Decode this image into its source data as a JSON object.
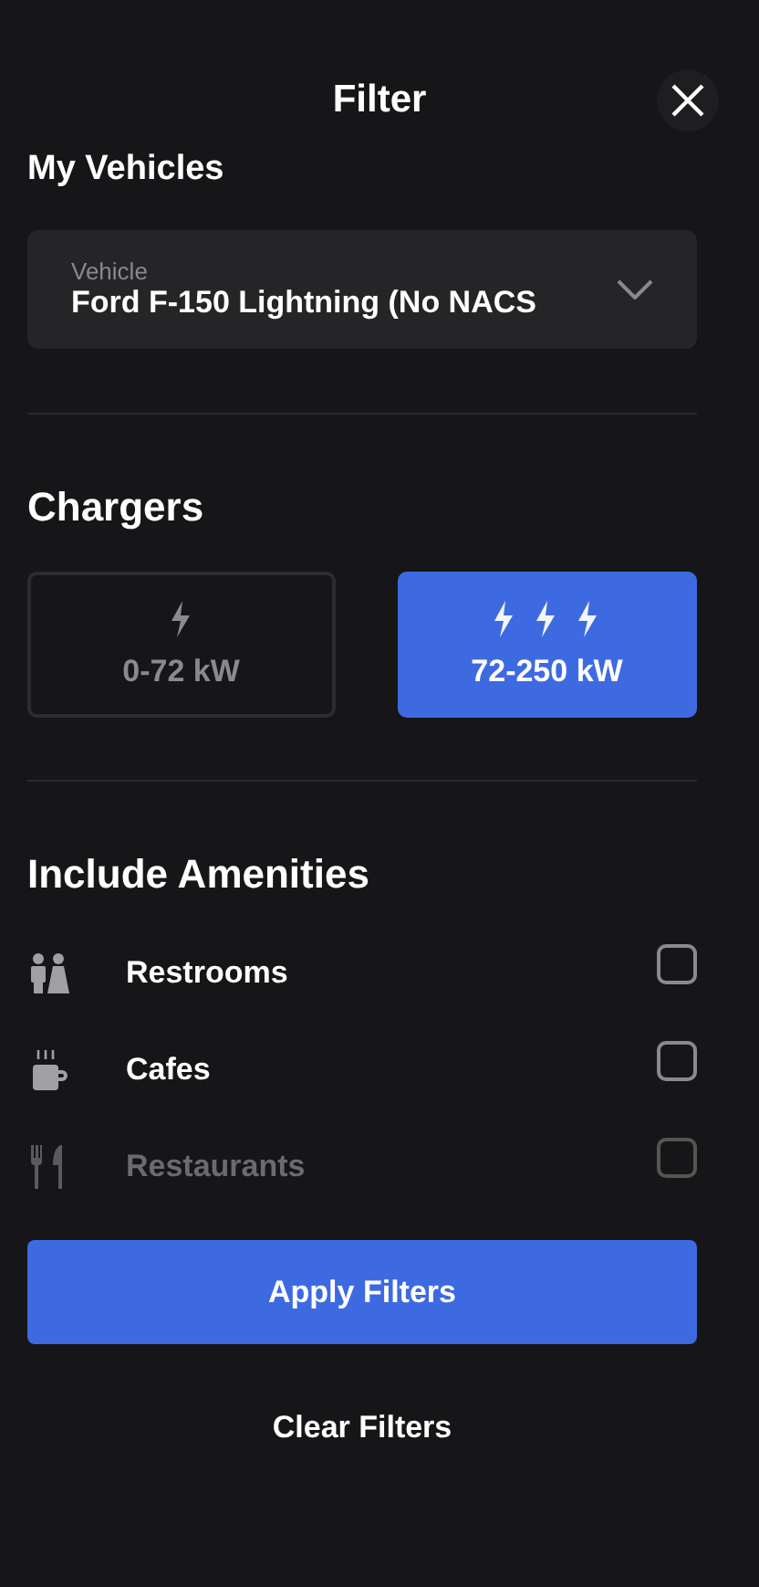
{
  "header": {
    "title": "Filter"
  },
  "vehicles": {
    "heading": "My Vehicles",
    "field": {
      "label": "Vehicle",
      "value": "Ford F-150 Lightning (No NACS"
    }
  },
  "chargers": {
    "heading": "Chargers",
    "options": [
      {
        "kind": "single",
        "label": "0-72 kW",
        "selected": false
      },
      {
        "kind": "triple",
        "label": "72-250 kW",
        "selected": true
      }
    ]
  },
  "amenities": {
    "heading": "Include Amenities",
    "items": [
      {
        "kind": "restroom",
        "label": "Restrooms",
        "checked": false,
        "disabled": false
      },
      {
        "kind": "cafe",
        "label": "Cafes",
        "checked": false,
        "disabled": false
      },
      {
        "kind": "restaurant",
        "label": "Restaurants",
        "checked": false,
        "disabled": true
      }
    ]
  },
  "apply_button": "Apply Filters",
  "clear_button": "Clear Filters"
}
